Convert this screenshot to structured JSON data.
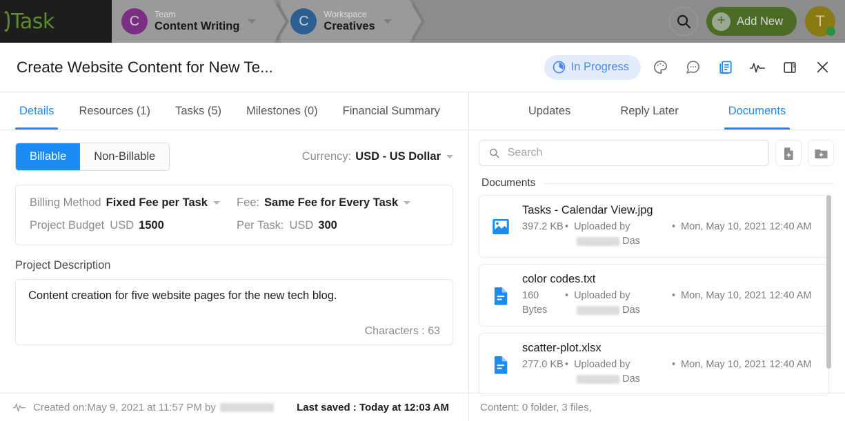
{
  "topbar": {
    "logo_text": "Task",
    "logo_icon": "circle-arc-logo-icon",
    "team": {
      "kind": "Team",
      "name": "Content Writing",
      "avatar_letter": "C"
    },
    "workspace": {
      "kind": "Workspace",
      "name": "Creatives",
      "avatar_letter": "C"
    },
    "search_icon": "search-icon",
    "add_new_label": "Add New",
    "avatar_letter": "T"
  },
  "modal": {
    "title": "Create Website Content for New Te...",
    "status": "In Progress",
    "status_icon": "half-filled-clock-icon",
    "actions": [
      {
        "name": "palette-icon"
      },
      {
        "name": "comment-icon"
      },
      {
        "name": "documents-icon"
      },
      {
        "name": "activity-icon"
      },
      {
        "name": "split-panel-icon"
      },
      {
        "name": "close-icon"
      }
    ]
  },
  "left_tabs": [
    {
      "label": "Details",
      "active": true
    },
    {
      "label": "Resources (1)",
      "active": false
    },
    {
      "label": "Tasks (5)",
      "active": false
    },
    {
      "label": "Milestones (0)",
      "active": false
    },
    {
      "label": "Financial Summary",
      "active": false
    }
  ],
  "right_tabs": [
    {
      "label": "Updates",
      "active": false
    },
    {
      "label": "Reply Later",
      "active": false
    },
    {
      "label": "Documents",
      "active": true
    }
  ],
  "details": {
    "billable_label": "Billable",
    "non_billable_label": "Non-Billable",
    "currency_label": "Currency:",
    "currency_value": "USD - US Dollar",
    "billing_method_label": "Billing Method",
    "billing_method_value": "Fixed Fee per Task",
    "fee_label": "Fee:",
    "fee_value": "Same Fee for Every Task",
    "project_budget_label": "Project Budget",
    "project_budget_currency": "USD",
    "project_budget_value": "1500",
    "per_task_label": "Per Task:",
    "per_task_currency": "USD",
    "per_task_value": "300",
    "description_label": "Project Description",
    "description_text": "Content creation for five website pages for the new tech blog.",
    "characters_label": "Characters : 63"
  },
  "documents": {
    "search_placeholder": "Search",
    "search_value": "",
    "add_file_icon": "add-file-icon",
    "add_folder_icon": "add-folder-icon",
    "section_label": "Documents",
    "items": [
      {
        "name": "Tasks - Calendar View.jpg",
        "icon": "image-file-icon",
        "size": "397.2 KB",
        "uploaded_by": "Uploaded by",
        "uploader_suffix": "Das",
        "date": "Mon, May 10, 2021 12:40 AM"
      },
      {
        "name": "color codes.txt",
        "icon": "text-file-icon",
        "size": "160 Bytes",
        "uploaded_by": "Uploaded by",
        "uploader_suffix": "Das",
        "date": "Mon, May 10, 2021 12:40 AM"
      },
      {
        "name": "scatter-plot.xlsx",
        "icon": "text-file-icon",
        "size": "277.0 KB",
        "uploaded_by": "Uploaded by",
        "uploader_suffix": "Das",
        "date": "Mon, May 10, 2021 12:40 AM"
      }
    ]
  },
  "footer": {
    "created_icon": "activity-icon",
    "created_text": "Created on:May 9, 2021 at 11:57 PM by",
    "last_saved": "Last saved : Today at 12:03 AM",
    "content_summary": "Content: 0 folder, 3 files,"
  },
  "colors": {
    "accent_blue": "#1b8cf3",
    "status_blue": "#4d88f0",
    "logo_green": "#5f8a2e",
    "avatar_purple": "#7a2e84",
    "avatar_blue": "#2a5f92",
    "online_green": "#2a8f3e"
  }
}
